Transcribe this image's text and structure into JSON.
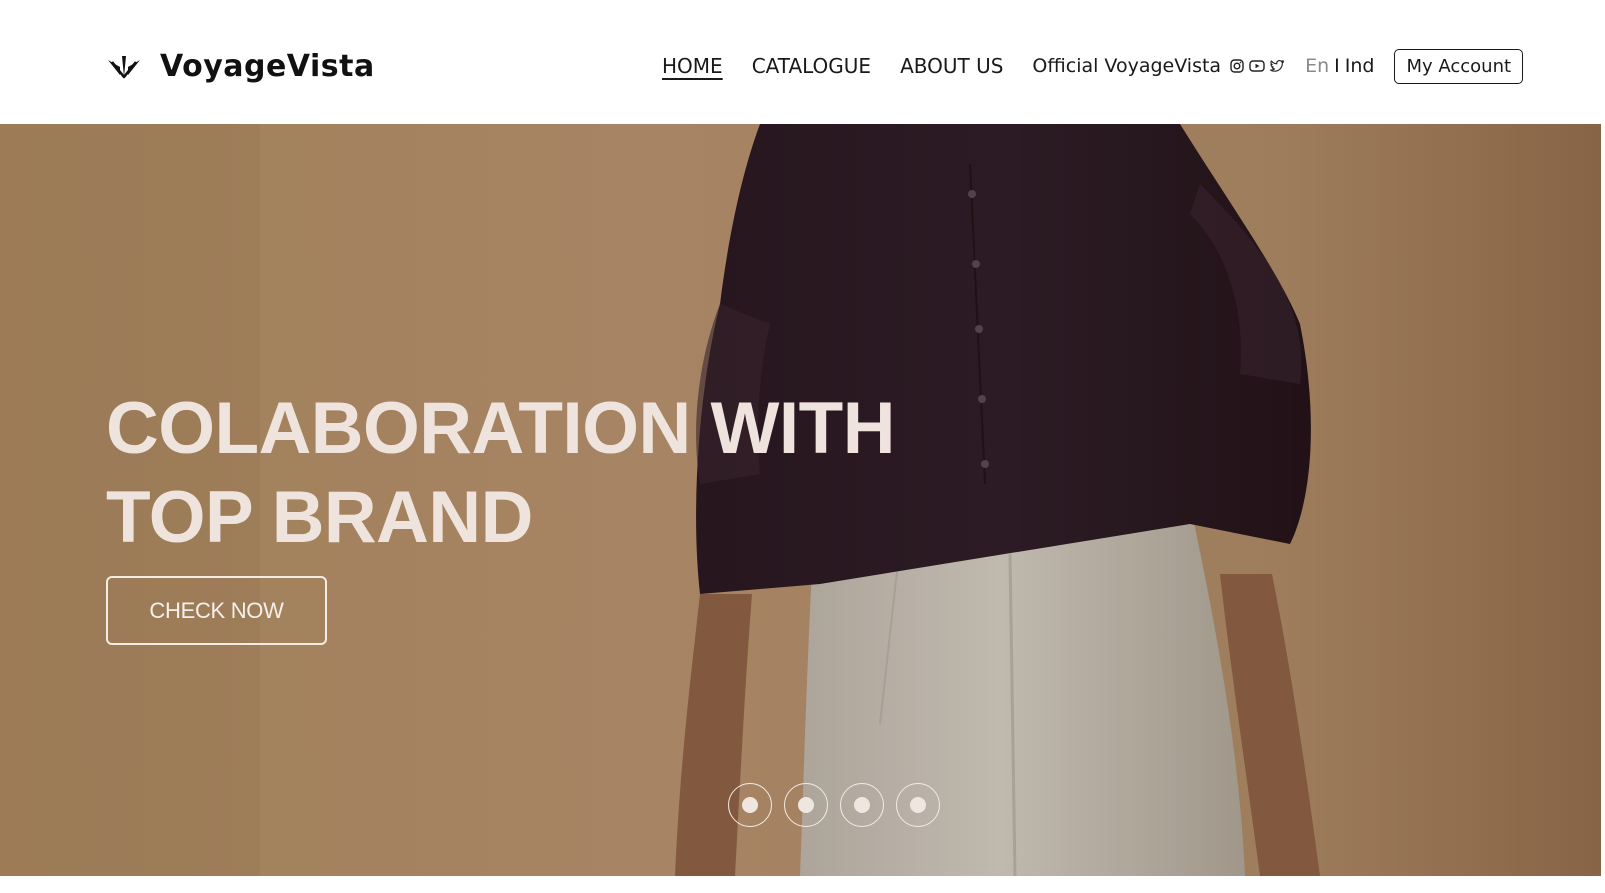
{
  "brand": {
    "name": "VoyageVista",
    "logo_icon": "chevron-leaf-icon"
  },
  "nav": {
    "items": [
      {
        "label": "HOME",
        "active": true
      },
      {
        "label": "CATALOGUE",
        "active": false
      },
      {
        "label": "ABOUT US",
        "active": false
      }
    ],
    "official_label": "Official VoyageVista",
    "social": [
      "instagram-icon",
      "youtube-icon",
      "twitter-icon"
    ],
    "language": {
      "en": "En",
      "separator": "I",
      "ind": "Ind"
    },
    "account_label": "My Account"
  },
  "hero": {
    "title_line1": "COLABORATION WITH",
    "title_line2": "TOP BRAND",
    "cta_label": "CHECK NOW",
    "slides_count": 4,
    "active_slide": 1
  },
  "colors": {
    "hero_background": "#a98661",
    "hero_text": "#efe4dd",
    "nav_text": "#1a1a1a",
    "lang_inactive": "#8a8a8a"
  }
}
